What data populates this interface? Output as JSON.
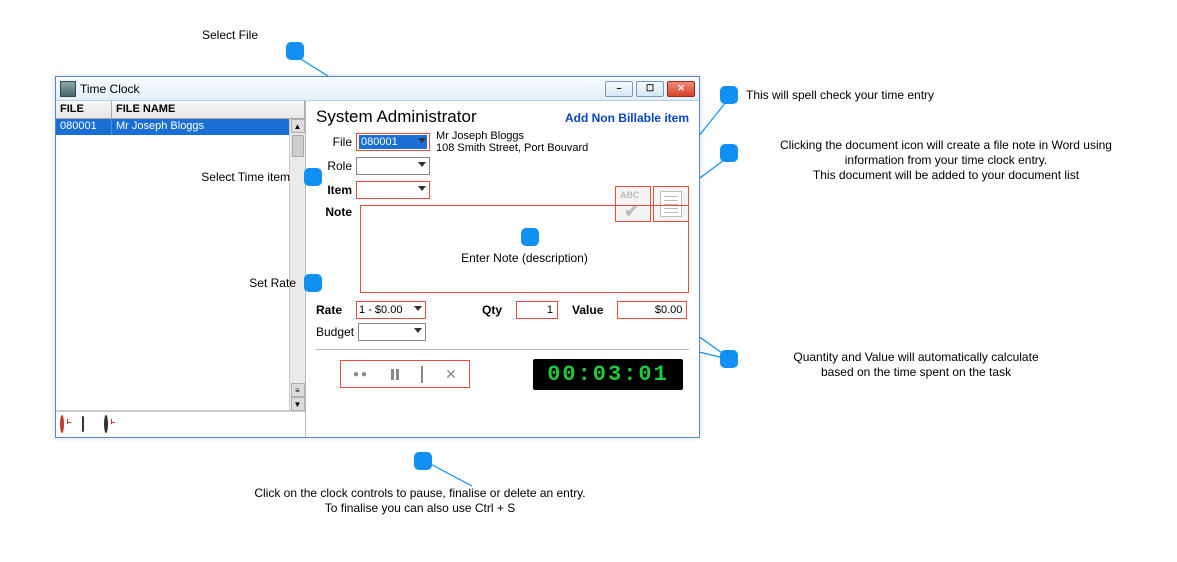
{
  "window": {
    "title": "Time Clock",
    "controls": {
      "min": "–",
      "max": "☐",
      "close": "✕"
    }
  },
  "grid": {
    "headers": {
      "file": "FILE",
      "name": "FILE NAME"
    },
    "rows": [
      {
        "file": "080001",
        "name": "Mr Joseph Bloggs"
      }
    ]
  },
  "main": {
    "heading": "System Administrator",
    "add_link": "Add Non Billable item",
    "labels": {
      "file": "File",
      "role": "Role",
      "item": "Item",
      "note": "Note",
      "rate": "Rate",
      "qty": "Qty",
      "value": "Value",
      "budget": "Budget"
    },
    "file_value": "080001",
    "client_name": "Mr Joseph Bloggs",
    "client_addr": "108 Smith Street, Port Bouvard",
    "note_placeholder": "Enter Note (description)",
    "rate_value": "1 - $0.00",
    "qty_value": "1",
    "value_value": "$0.00",
    "timer": "00:03:01"
  },
  "annotations": {
    "select_file": "Select File",
    "select_item": "Select Time item",
    "set_rate": "Set Rate",
    "spell": "This will spell check your time entry",
    "doc1": "Clicking the document icon will create a file note in Word using",
    "doc2": "information from your time clock entry.",
    "doc3": "This document will be added to your document list",
    "qtyval1": "Quantity and Value will automatically calculate",
    "qtyval2": "based on the time spent on the task",
    "controls1": "Click on the clock controls to pause, finalise or delete an entry.",
    "controls2": "To finalise you can also use Ctrl + S"
  }
}
